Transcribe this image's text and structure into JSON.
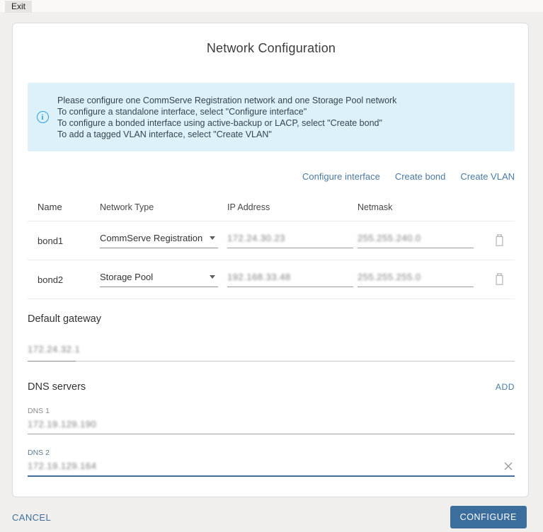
{
  "top_bar": {
    "exit_label": "Exit"
  },
  "dialog": {
    "title": "Network Configuration",
    "info": {
      "lines": [
        "Please configure one CommServe Registration network and one Storage Pool network",
        "To configure a standalone interface, select \"Configure interface\"",
        "To configure a bonded interface using active-backup or LACP, select \"Create bond\"",
        "To add a tagged VLAN interface, select \"Create VLAN\""
      ]
    },
    "actions": [
      "Configure interface",
      "Create bond",
      "Create VLAN"
    ],
    "table": {
      "headers": [
        "Name",
        "Network Type",
        "IP Address",
        "Netmask"
      ],
      "rows": [
        {
          "name": "bond1",
          "network_type": "CommServe Registration",
          "ip_address": "172.24.30.23",
          "netmask": "255.255.240.0",
          "redacted_fields": [
            "ip_address",
            "netmask"
          ]
        },
        {
          "name": "bond2",
          "network_type": "Storage Pool",
          "ip_address": "192.168.33.48",
          "netmask": "255.255.255.0",
          "redacted_fields": [
            "ip_address",
            "netmask"
          ]
        }
      ]
    },
    "default_gateway": {
      "label": "Default gateway",
      "value": "172.24.32.1",
      "redacted": true
    },
    "dns": {
      "heading": "DNS servers",
      "add_label": "ADD",
      "entries": [
        {
          "label": "DNS 1",
          "value": "172.19.129.190",
          "redacted": true,
          "focused": false
        },
        {
          "label": "DNS 2",
          "value": "172.19.129.164",
          "redacted": true,
          "focused": true
        }
      ]
    }
  },
  "footer": {
    "cancel_label": "CANCEL",
    "configure_label": "CONFIGURE"
  },
  "colors": {
    "accent_link": "#4a7aa3",
    "configure_button_bg": "#3b6d9d",
    "info_box_bg": "#ddf1fb",
    "info_icon": "#2da1d8",
    "focused_underline": "#41719b",
    "page_bg": "#f1efee"
  }
}
